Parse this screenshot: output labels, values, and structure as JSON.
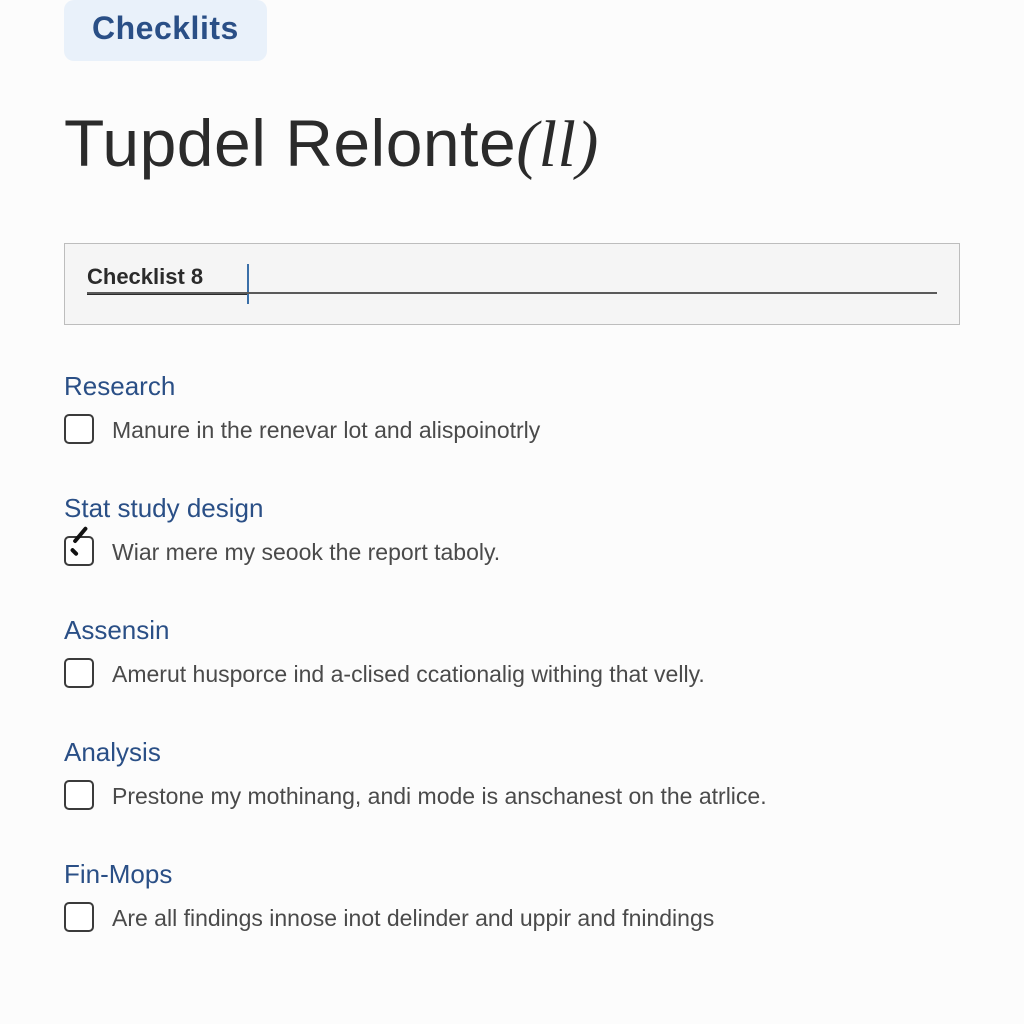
{
  "topTab": "Checklits",
  "title": {
    "main": "Tupdel Relonte",
    "suffix": "(ll)"
  },
  "checklistBox": {
    "label": "Checklist 8"
  },
  "sections": [
    {
      "title": "Research",
      "items": [
        {
          "checked": false,
          "text": "Manure in the renevar lot and alispoinotrly"
        }
      ]
    },
    {
      "title": "Stat study design",
      "items": [
        {
          "checked": true,
          "text": "Wiar mere my seook the report taboly."
        }
      ]
    },
    {
      "title": "Assensin",
      "items": [
        {
          "checked": false,
          "text": "Amerut husporce ind a-clised ccationalig withing that velly."
        }
      ]
    },
    {
      "title": "Analysis",
      "items": [
        {
          "checked": false,
          "text": "Prestone my mothinang, andi mode is anschanest on the atrlice."
        }
      ]
    },
    {
      "title": "Fin-Mops",
      "items": [
        {
          "checked": false,
          "text": "Are all findings innose inot delinder and uppir and fnindings"
        }
      ]
    }
  ]
}
